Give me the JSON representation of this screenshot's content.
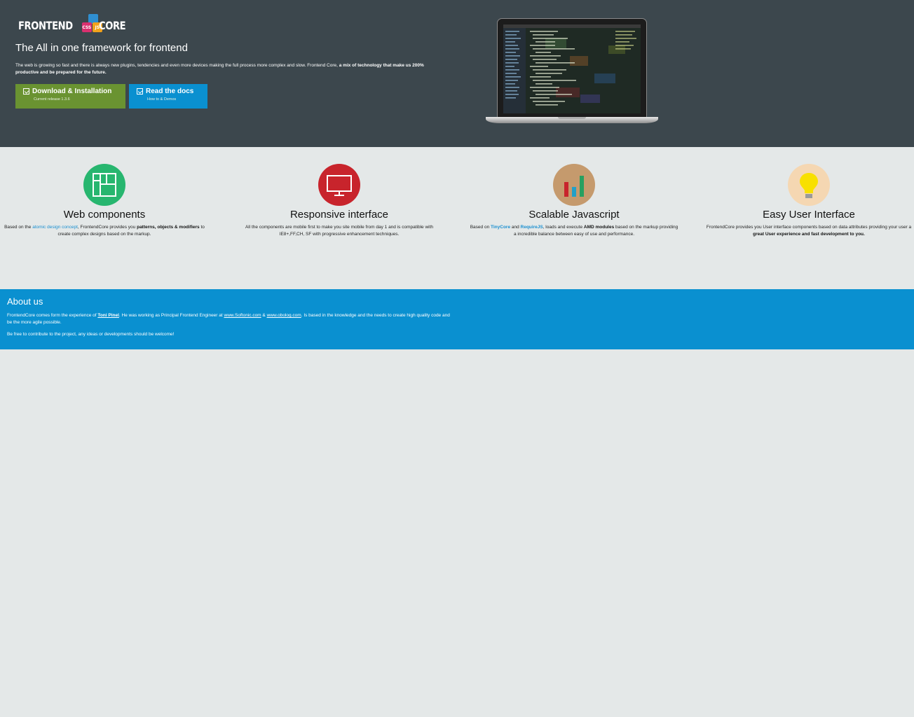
{
  "hero": {
    "logo_left": "FRONTEND",
    "logo_right": "CORE",
    "logo_css": "CSS",
    "logo_js": "JS",
    "tagline": "The All in one framework for frontend",
    "intro_text": "The web is growing so fast and there is always new plugins, tendencies and even more devices making the full process more complex and slow. Frontend Core, ",
    "intro_bold": "a mix of technology that make us 200% productive and be prepared for the future."
  },
  "buttons": {
    "download_label": "Download & Installation",
    "download_sub": "Current release 1.3.6",
    "docs_label": "Read the docs",
    "docs_sub": "How to & Demos"
  },
  "features": [
    {
      "title": "Web components",
      "color": "#27b66f",
      "icon": "layout-grid-icon",
      "t1": "Based on the ",
      "link": "atomic design concept",
      "t2": ", FrontendCore provides you ",
      "bold": "patterns, objects & modifiers",
      "t3": " to create complex designs based on the markup."
    },
    {
      "title": "Responsive interface",
      "color": "#c8242c",
      "icon": "monitor-icon",
      "t1": "All the components are mobile first to make you site mobile from day 1 and is compatible with IE8+,FF,CH, SF with progressive enhancement techniques."
    },
    {
      "title": "Scalable Javascript",
      "color": "#c59a6d",
      "icon": "bar-chart-icon",
      "t1": "Based on ",
      "link1": "TinyCore",
      "t2": " and ",
      "link2": "RequireJS",
      "t3": ", loads and execute ",
      "bold": "AMD modules",
      "t4": " based on the markup providing a incredible balance between easy of use and performance."
    },
    {
      "title": "Easy User Interface",
      "color": "#f5d7b2",
      "icon": "lightbulb-icon",
      "t1": "FrontendCore provides you User interface components based on data attributes providing your user a ",
      "bold": "great User experience and fast development to you."
    }
  ],
  "about": {
    "title": "About us",
    "p1a": "FrontendCore comes form the experience of ",
    "author": "Toni Pinel",
    "p1b": ". He was working as Principal Frontend Engineer at ",
    "link1": "www.Softonic.com",
    "amp": " & ",
    "link2": "www.obolog.com",
    "p1c": ". Is based in the knowledge and the needs to create high quality code and be the more agile possible.",
    "p2": "Be free to contribute to the project, any ideas or developments should be welcome!"
  }
}
